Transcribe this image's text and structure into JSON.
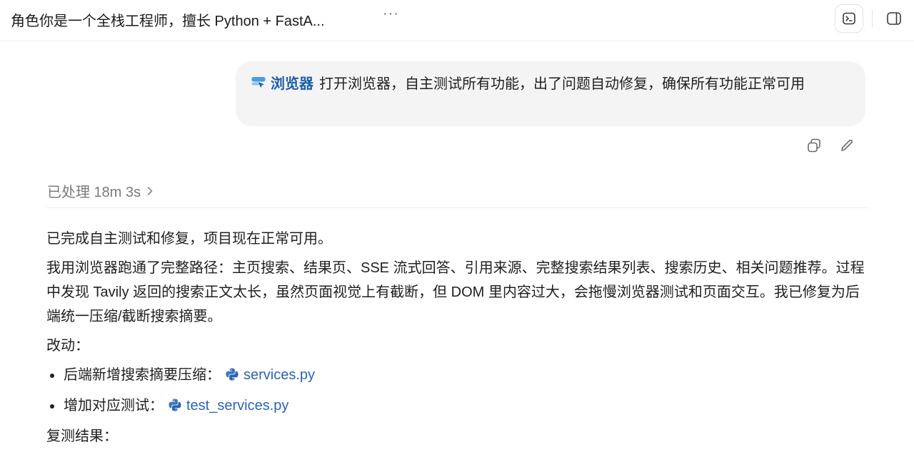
{
  "header": {
    "title": "角色你是一个全栈工程师，擅长 Python + FastA...",
    "more_label": "···",
    "terminal_icon": "terminal-icon",
    "panel_icon": "sidebar-panel-icon"
  },
  "user_message": {
    "chip_icon": "browser-icon",
    "chip_label": "浏览器",
    "text": "打开浏览器，自主测试所有功能，出了问题自动修复，确保所有功能正常可用",
    "actions": [
      "copy-icon",
      "edit-icon"
    ]
  },
  "processing": {
    "label": "已处理 18m 3s",
    "icon": "chevron-right-icon"
  },
  "response": {
    "p1": "已完成自主测试和修复，项目现在正常可用。",
    "p2": "我用浏览器跑通了完整路径：主页搜索、结果页、SSE 流式回答、引用来源、完整搜索结果列表、搜索历史、相关问题推荐。过程中发现 Tavily 返回的搜索正文太长，虽然页面视觉上有截断，但 DOM 里内容过大，会拖慢浏览器测试和页面交互。我已修复为后端统一压缩/截断搜索摘要。",
    "changes_label": "改动：",
    "changes": [
      {
        "text": "后端新增搜索摘要压缩：",
        "file": "services.py",
        "icon": "python-icon"
      },
      {
        "text": "增加对应测试：",
        "file": "test_services.py",
        "icon": "python-icon"
      }
    ],
    "retest_label": "复测结果："
  },
  "colors": {
    "link": "#2c63b6",
    "chip": "#1e5fa8",
    "bubble_bg": "#f4f4f4",
    "muted": "#7a7a7a"
  }
}
